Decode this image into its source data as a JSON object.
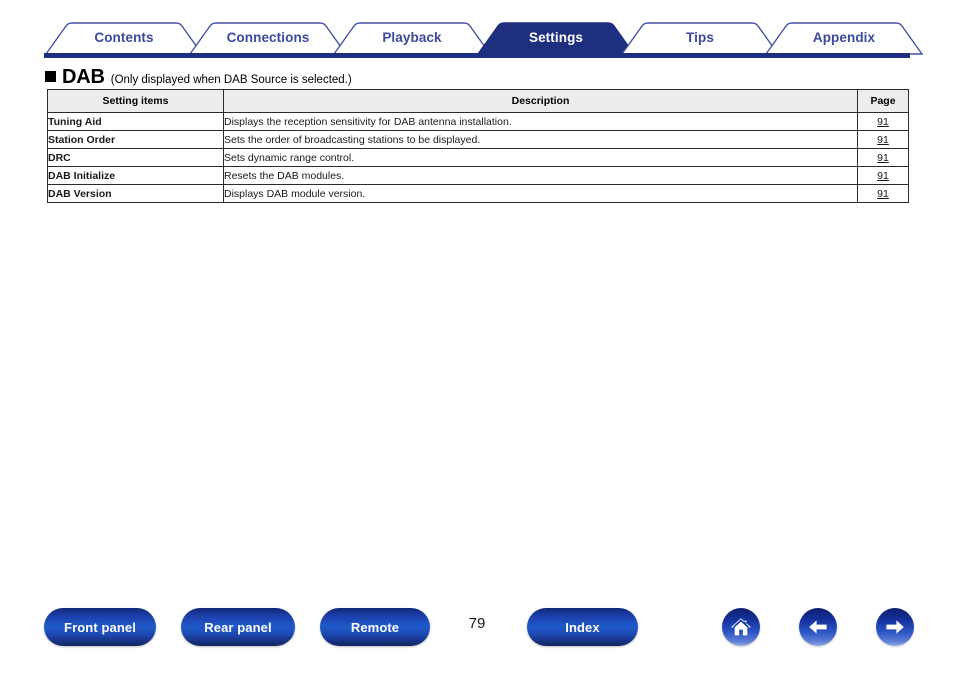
{
  "nav": {
    "tabs": [
      {
        "label": "Contents",
        "active": false
      },
      {
        "label": "Connections",
        "active": false
      },
      {
        "label": "Playback",
        "active": false
      },
      {
        "label": "Settings",
        "active": true
      },
      {
        "label": "Tips",
        "active": false
      },
      {
        "label": "Appendix",
        "active": false
      }
    ],
    "accent_color": "#1f2f7f",
    "tab_text_color": "#3b4a9e",
    "active_tab_text_color": "#ffffff"
  },
  "heading": {
    "bullet": "square-bullet",
    "title": "DAB",
    "note": "(Only displayed when DAB Source is selected.)"
  },
  "table": {
    "columns": [
      "Setting items",
      "Description",
      "Page"
    ],
    "rows": [
      {
        "item": "Tuning Aid",
        "description": "Displays the reception sensitivity for DAB antenna installation.",
        "page": "91"
      },
      {
        "item": "Station Order",
        "description": "Sets the order of broadcasting stations to be displayed.",
        "page": "91"
      },
      {
        "item": "DRC",
        "description": "Sets dynamic range control.",
        "page": "91"
      },
      {
        "item": "DAB Initialize",
        "description": "Resets the DAB modules.",
        "page": "91"
      },
      {
        "item": "DAB Version",
        "description": "Displays DAB module version.",
        "page": "91"
      }
    ]
  },
  "footer": {
    "buttons": [
      {
        "label": "Front panel"
      },
      {
        "label": "Rear panel"
      },
      {
        "label": "Remote"
      },
      {
        "label": "Index"
      }
    ],
    "page_number": "79",
    "icons": [
      {
        "name": "home-icon"
      },
      {
        "name": "arrow-left-icon"
      },
      {
        "name": "arrow-right-icon"
      }
    ],
    "button_color": "#1b40ad"
  }
}
